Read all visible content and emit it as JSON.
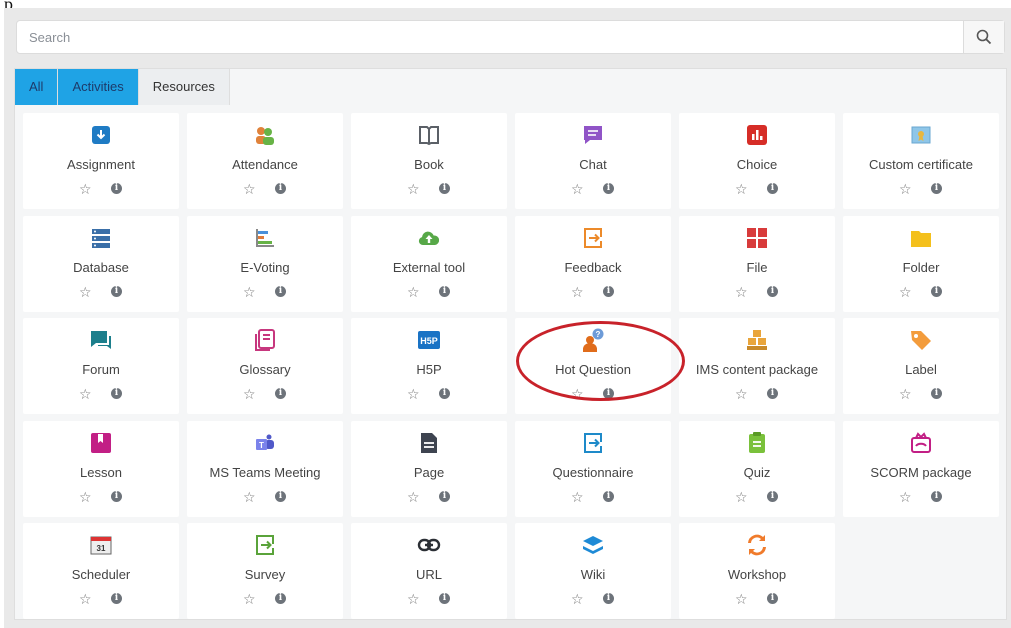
{
  "top_text": "p",
  "search": {
    "placeholder": "Search",
    "icon": "search-icon"
  },
  "tabs": [
    {
      "label": "All",
      "active": true
    },
    {
      "label": "Activities",
      "active": true
    },
    {
      "label": "Resources",
      "active": false
    }
  ],
  "colors": {
    "accent": "#1fa3e5",
    "highlight_ring": "#c8222a"
  },
  "modules": [
    {
      "label": "Assignment",
      "icon": "assignment-icon"
    },
    {
      "label": "Attendance",
      "icon": "attendance-icon"
    },
    {
      "label": "Book",
      "icon": "book-icon"
    },
    {
      "label": "Chat",
      "icon": "chat-icon"
    },
    {
      "label": "Choice",
      "icon": "choice-icon"
    },
    {
      "label": "Custom certificate",
      "icon": "certificate-icon"
    },
    {
      "label": "Database",
      "icon": "database-icon"
    },
    {
      "label": "E-Voting",
      "icon": "evoting-icon"
    },
    {
      "label": "External tool",
      "icon": "external-tool-icon"
    },
    {
      "label": "Feedback",
      "icon": "feedback-icon"
    },
    {
      "label": "File",
      "icon": "file-icon"
    },
    {
      "label": "Folder",
      "icon": "folder-icon"
    },
    {
      "label": "Forum",
      "icon": "forum-icon"
    },
    {
      "label": "Glossary",
      "icon": "glossary-icon"
    },
    {
      "label": "H5P",
      "icon": "h5p-icon"
    },
    {
      "label": "Hot Question",
      "icon": "hot-question-icon"
    },
    {
      "label": "IMS content package",
      "icon": "ims-package-icon"
    },
    {
      "label": "Label",
      "icon": "label-icon"
    },
    {
      "label": "Lesson",
      "icon": "lesson-icon"
    },
    {
      "label": "MS Teams Meeting",
      "icon": "teams-icon"
    },
    {
      "label": "Page",
      "icon": "page-icon"
    },
    {
      "label": "Questionnaire",
      "icon": "questionnaire-icon"
    },
    {
      "label": "Quiz",
      "icon": "quiz-icon"
    },
    {
      "label": "SCORM package",
      "icon": "scorm-icon"
    },
    {
      "label": "Scheduler",
      "icon": "scheduler-icon"
    },
    {
      "label": "Survey",
      "icon": "survey-icon"
    },
    {
      "label": "URL",
      "icon": "url-icon"
    },
    {
      "label": "Wiki",
      "icon": "wiki-icon"
    },
    {
      "label": "Workshop",
      "icon": "workshop-icon"
    }
  ],
  "scheduler_icon_text": "31"
}
